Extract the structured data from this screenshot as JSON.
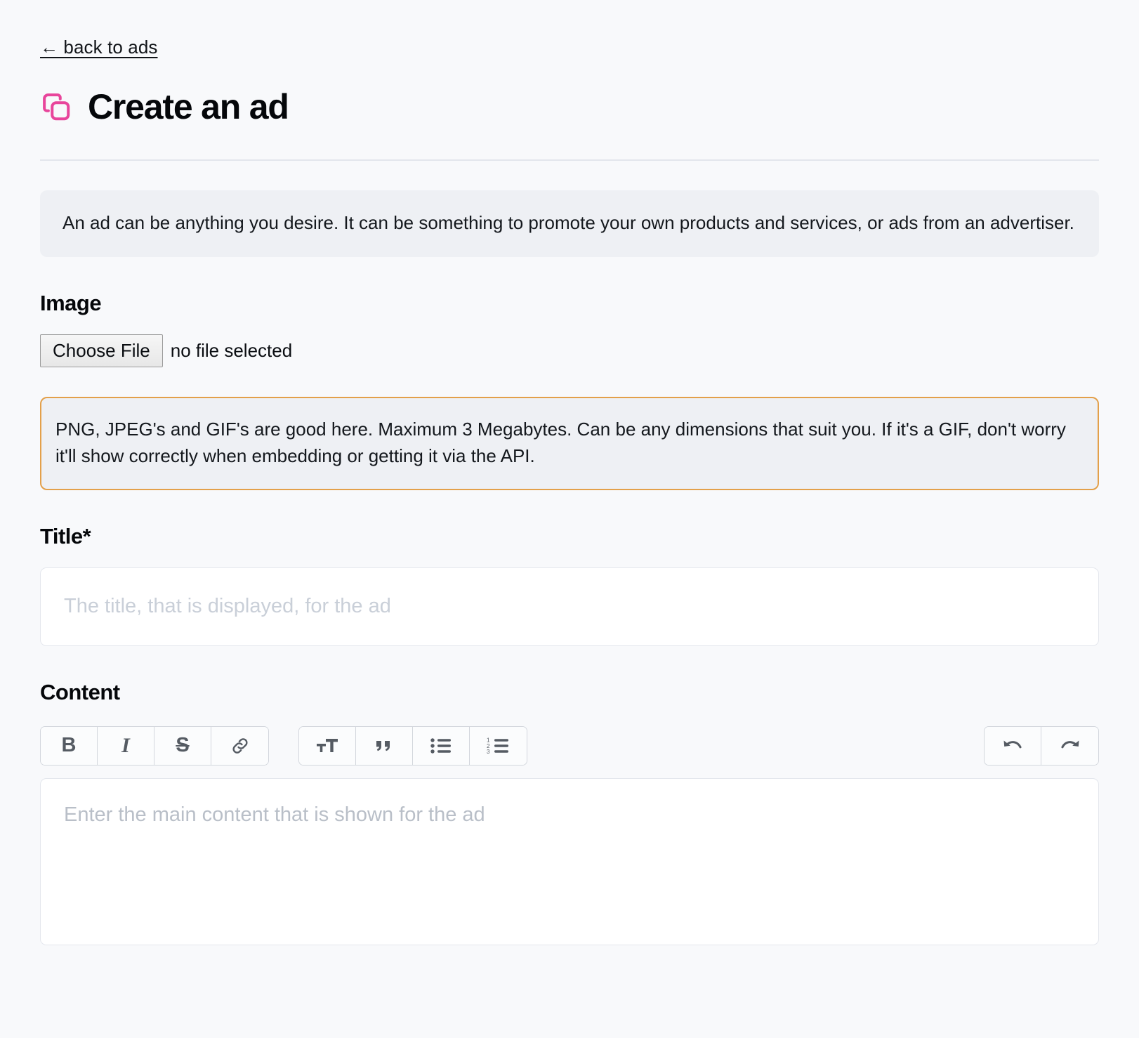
{
  "header": {
    "back_link": "← back to ads",
    "title": "Create an ad",
    "icon": "copy-duplicate-icon",
    "icon_color": "#e8459b"
  },
  "intro_callout": {
    "text": "An ad can be anything you desire. It can be something to promote your own products and services, or ads from an advertiser.",
    "background": "#eef0f4"
  },
  "image_section": {
    "label": "Image",
    "choose_file_label": "Choose File",
    "file_status": "no file selected",
    "help_callout": {
      "text": "PNG, JPEG's and GIF's are good here. Maximum 3 Megabytes. Can be any dimensions that suit you. If it's a GIF, don't worry it'll show correctly when embedding or getting it via the API.",
      "border_color": "#e3a04a",
      "background": "#eef0f4"
    }
  },
  "title_section": {
    "label": "Title*",
    "value": "",
    "placeholder": "The title, that is displayed, for the ad"
  },
  "content_section": {
    "label": "Content",
    "value": "",
    "placeholder": "Enter the main content that is shown for the ad",
    "toolbar": {
      "groups": [
        {
          "name": "formatting",
          "buttons": [
            {
              "name": "bold-icon",
              "label": "B",
              "title": "Bold"
            },
            {
              "name": "italic-icon",
              "label": "I",
              "title": "Italic"
            },
            {
              "name": "strikethrough-icon",
              "label": "S",
              "title": "Strikethrough"
            },
            {
              "name": "link-icon",
              "label": "",
              "title": "Link"
            }
          ]
        },
        {
          "name": "blocks",
          "buttons": [
            {
              "name": "heading-text-size-icon",
              "label": "",
              "title": "Heading"
            },
            {
              "name": "blockquote-icon",
              "label": "",
              "title": "Quote"
            },
            {
              "name": "bullet-list-icon",
              "label": "",
              "title": "Bulleted list"
            },
            {
              "name": "numbered-list-icon",
              "label": "",
              "title": "Numbered list"
            }
          ]
        },
        {
          "name": "history",
          "buttons": [
            {
              "name": "undo-icon",
              "label": "",
              "title": "Undo"
            },
            {
              "name": "redo-icon",
              "label": "",
              "title": "Redo"
            }
          ]
        }
      ]
    }
  }
}
